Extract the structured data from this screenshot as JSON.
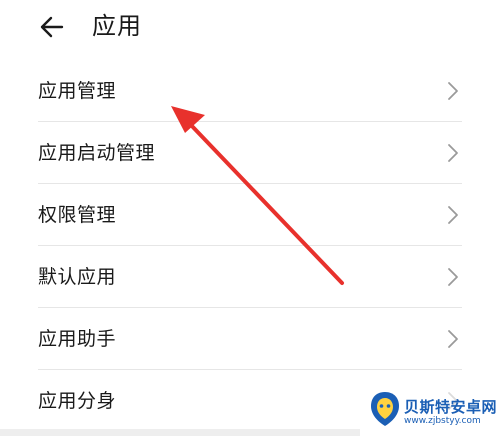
{
  "header": {
    "back_icon": "arrow-left-icon",
    "title": "应用"
  },
  "menu": {
    "items": [
      {
        "label": "应用管理",
        "icon": "chevron-right-icon"
      },
      {
        "label": "应用启动管理",
        "icon": "chevron-right-icon"
      },
      {
        "label": "权限管理",
        "icon": "chevron-right-icon"
      },
      {
        "label": "默认应用",
        "icon": "chevron-right-icon"
      },
      {
        "label": "应用助手",
        "icon": "chevron-right-icon"
      },
      {
        "label": "应用分身",
        "icon": "chevron-right-icon"
      }
    ]
  },
  "annotation": {
    "arrow_color": "#e8312c"
  },
  "watermark": {
    "name": "贝斯特安卓网",
    "url": "www.zjbstyy.com",
    "color": "#1b5fb5"
  },
  "colors": {
    "text": "#1a1a1a",
    "divider": "#e6e6e6",
    "chevron": "#9a9a9a",
    "background": "#ffffff"
  }
}
